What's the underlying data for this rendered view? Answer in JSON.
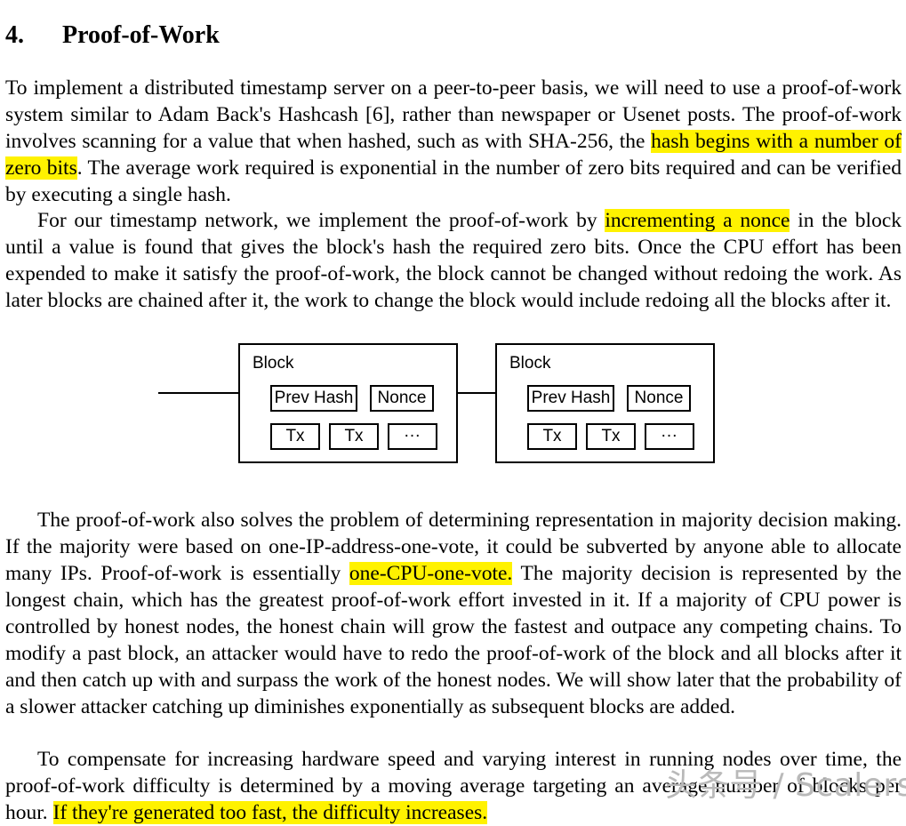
{
  "document": {
    "section_number": "4.",
    "section_title": "Proof-of-Work"
  },
  "paragraphs": {
    "p1": {
      "part1": "To implement a distributed timestamp server on a peer-to-peer basis, we will need to use a proof-of-work system similar to Adam Back's Hashcash [6], rather than newspaper or Usenet posts.  The proof-of-work involves scanning for a value that when hashed, such as with SHA-256, the ",
      "highlight1": "hash begins with a number of zero bits",
      "part2": ".  The average work required is exponential in the number of zero bits required and can be verified by executing a single hash."
    },
    "p2": {
      "part1": "For our timestamp network, we implement the proof-of-work by ",
      "highlight1": "incrementing a nonce",
      "part2": " in the block until a value is found that gives the block's hash the required zero bits.  Once the CPU effort has been expended to make it satisfy the proof-of-work, the block cannot be changed without redoing the work.  As later blocks are chained after it, the work to change the block would include redoing all the blocks after it."
    },
    "p3": {
      "part1": "The proof-of-work also solves the problem of determining representation in majority decision making.  If the majority were based on one-IP-address-one-vote, it could be subverted by anyone able to allocate many IPs.  Proof-of-work is essentially ",
      "highlight1": "one-CPU-one-vote.",
      "part2": "  The majority decision is represented by the longest chain, which has the greatest proof-of-work effort invested in it.  If a majority of CPU power is controlled by honest nodes, the honest chain will grow the fastest and outpace any competing chains.  To modify a past block, an attacker would have to redo the proof-of-work of the block and all blocks after it and then catch up with and surpass the work of the honest nodes.  We will show later that the probability of a slower attacker catching up diminishes exponentially as subsequent blocks are added."
    },
    "p4": {
      "part1": "To compensate for increasing hardware speed and varying interest in running nodes over time, the proof-of-work difficulty is determined by a moving average targeting an average number of blocks per hour.  ",
      "highlight1": "If they're generated too fast, the difficulty increases.",
      "part2": ""
    }
  },
  "diagram": {
    "blocks": [
      {
        "label": "Block",
        "prev_hash": "Prev Hash",
        "nonce": "Nonce",
        "tx1": "Tx",
        "tx2": "Tx",
        "more": "..."
      },
      {
        "label": "Block",
        "prev_hash": "Prev Hash",
        "nonce": "Nonce",
        "tx1": "Tx",
        "tx2": "Tx",
        "more": "..."
      }
    ]
  },
  "watermark": {
    "text": "头条号 / Scalers"
  },
  "colors": {
    "highlight": "#fff200",
    "text": "#000000",
    "background": "#ffffff",
    "watermark": "#b9b9b9"
  }
}
